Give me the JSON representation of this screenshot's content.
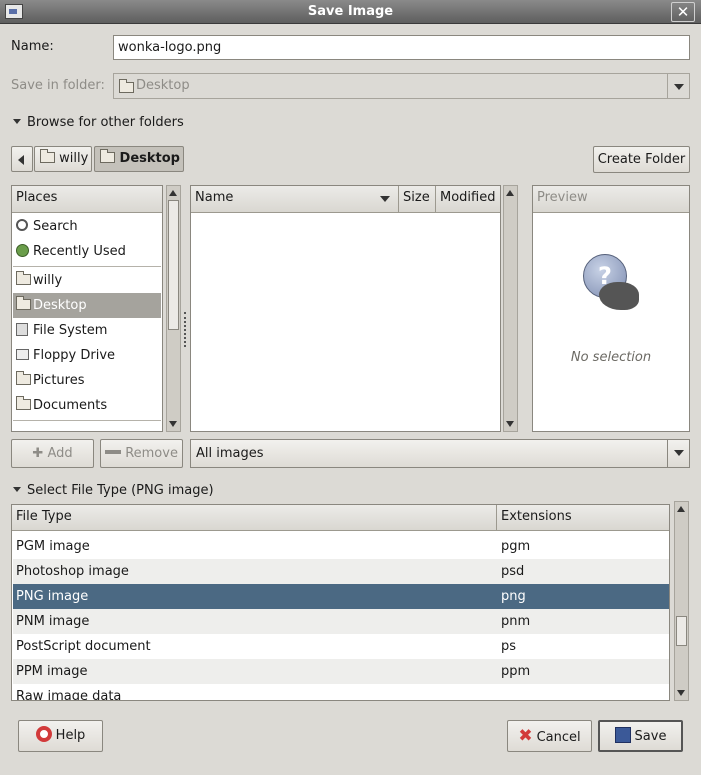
{
  "window": {
    "title": "Save Image",
    "close_glyph": "✕"
  },
  "name_field": {
    "label": "Name:",
    "value": "wonka-logo.png"
  },
  "save_in_folder": {
    "label": "Save in folder:",
    "value": "Desktop"
  },
  "browse": {
    "label": "Browse for other folders"
  },
  "path_bar": {
    "buttons": [
      {
        "label": "willy"
      },
      {
        "label": "Desktop"
      }
    ],
    "create_folder_label": "Create Folder"
  },
  "places": {
    "header": "Places",
    "items": [
      {
        "label": "Search",
        "icon": "search-icon"
      },
      {
        "label": "Recently Used",
        "icon": "recent-icon"
      },
      {
        "label": "willy",
        "icon": "folder-icon"
      },
      {
        "label": "Desktop",
        "icon": "folder-icon",
        "selected": true
      },
      {
        "label": "File System",
        "icon": "drive-icon"
      },
      {
        "label": "Floppy Drive",
        "icon": "floppy-icon"
      },
      {
        "label": "Pictures",
        "icon": "folder-icon"
      },
      {
        "label": "Documents",
        "icon": "folder-icon"
      }
    ],
    "add_label": "Add",
    "remove_label": "Remove"
  },
  "files": {
    "columns": {
      "name": "Name",
      "size": "Size",
      "modified": "Modified"
    }
  },
  "preview": {
    "header": "Preview",
    "empty_text": "No selection"
  },
  "filter": {
    "value": "All images"
  },
  "file_type": {
    "label": "Select File Type (PNG image)",
    "columns": {
      "type": "File Type",
      "extensions": "Extensions"
    },
    "rows": [
      {
        "type": "PGM image",
        "ext": "pgm"
      },
      {
        "type": "Photoshop image",
        "ext": "psd"
      },
      {
        "type": "PNG image",
        "ext": "png",
        "selected": true
      },
      {
        "type": "PNM image",
        "ext": "pnm"
      },
      {
        "type": "PostScript document",
        "ext": "ps"
      },
      {
        "type": "PPM image",
        "ext": "ppm"
      },
      {
        "type": "Raw image data",
        "ext": ""
      }
    ]
  },
  "buttons": {
    "help": "Help",
    "cancel": "Cancel",
    "save": "Save"
  },
  "colors": {
    "selection": "#4b6983",
    "places_selected": "#a5a39d"
  }
}
